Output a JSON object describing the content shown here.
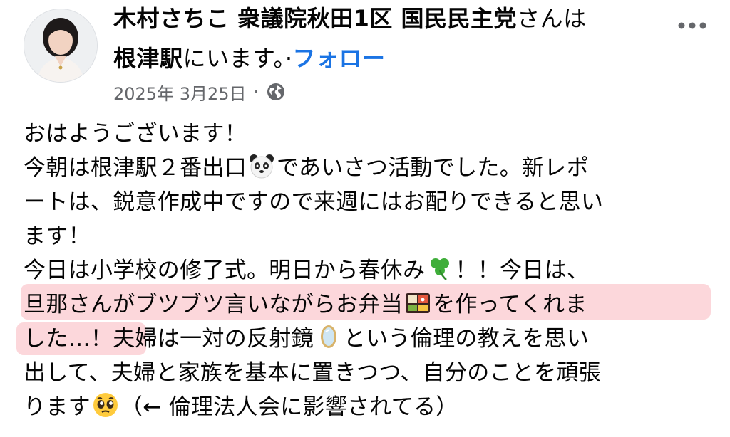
{
  "post": {
    "author": "木村さちこ 衆議院秋田1区 国民民主党",
    "checkin_prefix": "さんは",
    "location": "根津駅",
    "checkin_suffix": "にいます。·",
    "follow_label": "フォロー",
    "date": "2025年 3月25日",
    "separator": "·",
    "audience_icon": "globe-icon",
    "more_icon": "more-options-icon"
  },
  "body_lines": [
    {
      "text": "おはようございます！"
    },
    {
      "before": "今朝は根津駅２番出口",
      "emoji": "panda-emoji",
      "after": "であいさつ活動でした。新レポ"
    },
    {
      "text": "ートは、鋭意作成中ですので来週にはお配りできると思い"
    },
    {
      "text": "ます！"
    },
    {
      "before": "今日は小学校の修了式。明日から春休み",
      "emoji": "clover-emoji",
      "after": "！！今日は、"
    },
    {
      "before": "旦那さんがブツブツ言いながらお弁当",
      "emoji": "bento-emoji",
      "after": "を作ってくれま"
    },
    {
      "before": "した…！夫婦は一対の反射鏡",
      "emoji": "mirror-emoji",
      "after": "という倫理の教えを思い"
    },
    {
      "text": "出して、夫婦と家族を基本に置きつつ、自分のことを頑張"
    },
    {
      "before": "ります",
      "emoji": "pleading-face-emoji",
      "after": "（← 倫理法人会に影響されてる）"
    }
  ],
  "highlight_color": "#f7a0aa"
}
